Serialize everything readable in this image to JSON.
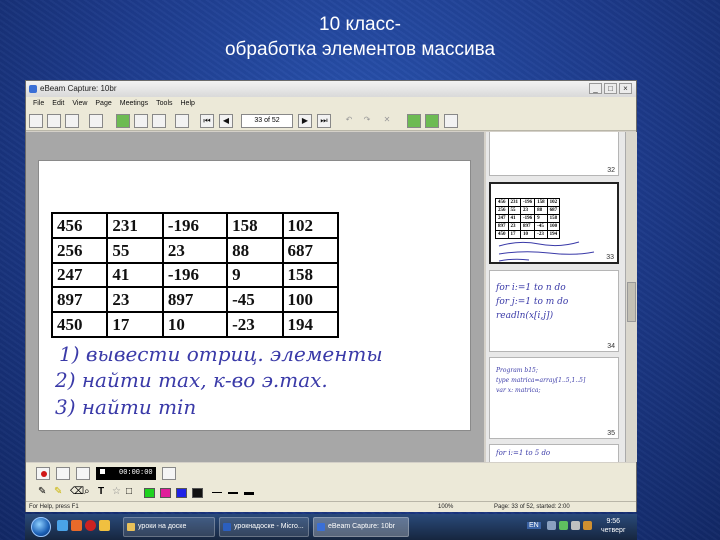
{
  "slide": {
    "title_line1": "10 класс-",
    "title_line2": "обработка элементов массива"
  },
  "window": {
    "title": "eBeam Capture: 10br",
    "menu": [
      "File",
      "Edit",
      "View",
      "Page",
      "Meetings",
      "Tools",
      "Help"
    ],
    "page_indicator": "33 of 52"
  },
  "table": [
    [
      "456",
      "231",
      "-196",
      "158",
      "102"
    ],
    [
      "256",
      "55",
      "23",
      "88",
      "687"
    ],
    [
      "247",
      "41",
      "-196",
      "9",
      "158"
    ],
    [
      "897",
      "23",
      "897",
      "-45",
      "100"
    ],
    [
      "450",
      "17",
      "10",
      "-23",
      "194"
    ]
  ],
  "handwriting": {
    "line1": "1) вывести отриц. элементы",
    "line2": "2) найти max, к-во э.max.",
    "line3": "3) найти min"
  },
  "thumbnails": [
    {
      "num": "32"
    },
    {
      "num": "33",
      "active": true
    },
    {
      "num": "34",
      "text": [
        "for i:=1 to n do",
        "for j:=1 to m do",
        "readln(x[i,j])"
      ]
    },
    {
      "num": "35",
      "text": [
        "Program b15;",
        "type matrica=array[1..5,1..5]",
        "var x: matrica;"
      ]
    },
    {
      "num": "",
      "text": [
        "for i:=1 to 5 do"
      ]
    }
  ],
  "recorder": {
    "timer": "00:00:00"
  },
  "colors": {
    "palette": [
      "#1fd21f",
      "#e01e9a",
      "#1e22e6",
      "#111111"
    ],
    "accent": "#d01515"
  },
  "status": {
    "help": "For Help, press F1",
    "zoom": "100%",
    "page": "Page: 33 of 52, started: 2:00"
  },
  "taskbar": {
    "buttons": [
      "уроки на доске",
      "урокнадоске - Micro...",
      "eBeam Capture: 10br"
    ],
    "lang": "EN",
    "time": "9:56",
    "day": "четверг"
  }
}
